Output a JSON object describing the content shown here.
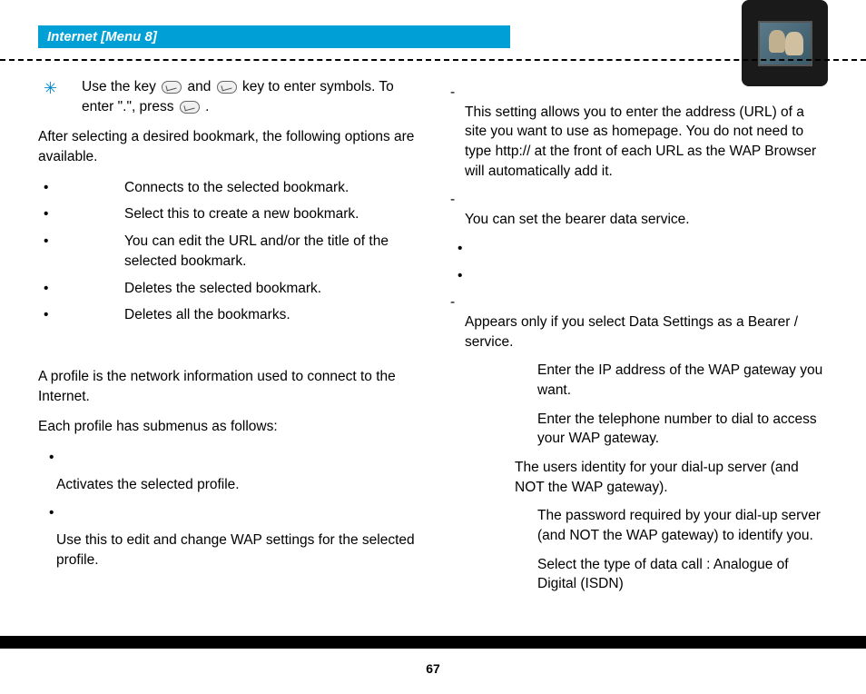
{
  "header": {
    "title": "Internet [Menu 8]"
  },
  "left": {
    "tip_pre": "Use the key ",
    "tip_mid": " and ",
    "tip_post": " key to enter symbols. To enter \".\", press ",
    "tip_end": " .",
    "after_bookmark": "After selecting a desired bookmark, the following options are available.",
    "bm_items": [
      "Connects to the selected bookmark.",
      "Select this to create a new bookmark.",
      "You can edit the URL and/or the title of the selected bookmark.",
      "Deletes the selected bookmark.",
      "Deletes all the bookmarks."
    ],
    "profile_intro": "A profile is the network information used to connect to the Internet.",
    "profile_sub": "Each profile has submenus as follows:",
    "activate": "Activates the selected profile.",
    "settings": "Use this to edit and change WAP settings for the selected profile."
  },
  "right": {
    "homepage": "This setting allows you to enter the address (URL) of a site you want to use as homepage. You do not need to type http:// at the front of each URL as the WAP Browser will automatically add it.",
    "bearer": "You can set the bearer data service.",
    "data_settings": "Appears only if you select Data Settings as a Bearer / service.",
    "ip": "Enter the IP address of the WAP gateway you want.",
    "dial": "Enter the telephone number to dial to access your WAP gateway.",
    "userid": "The users identity for your dial-up server (and NOT the WAP gateway).",
    "password": "The password required by your dial-up server (and NOT the WAP gateway) to identify you.",
    "calltype": "Select the type of data call : Analogue of Digital (ISDN)"
  },
  "page": "67"
}
